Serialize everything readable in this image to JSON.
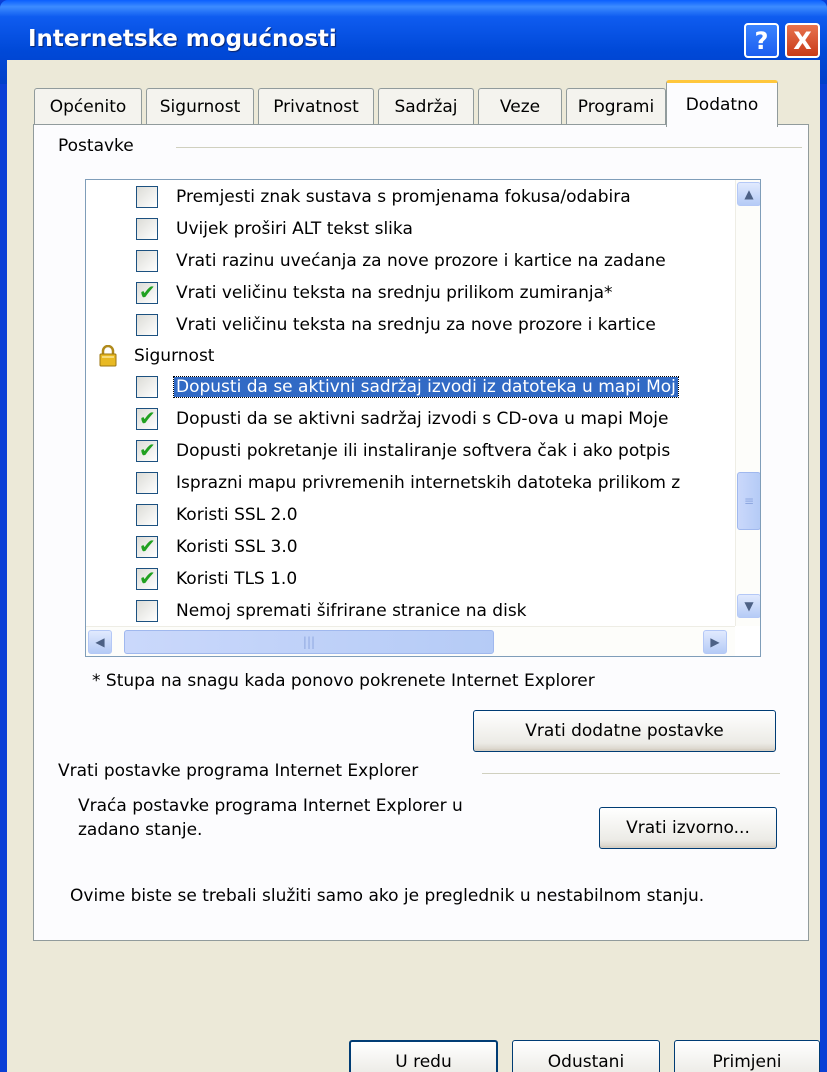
{
  "window": {
    "title": "Internetske mogućnosti",
    "help_label": "?",
    "close_label": "X"
  },
  "tabs": [
    {
      "label": "Općenito"
    },
    {
      "label": "Sigurnost"
    },
    {
      "label": "Privatnost"
    },
    {
      "label": "Sadržaj"
    },
    {
      "label": "Veze"
    },
    {
      "label": "Programi"
    },
    {
      "label": "Dodatno"
    }
  ],
  "active_tab": "Dodatno",
  "settings": {
    "group_label": "Postavke",
    "items": [
      {
        "label": "Premjesti znak sustava s promjenama fokusa/odabira",
        "checked": false
      },
      {
        "label": "Uvijek proširi ALT tekst slika",
        "checked": false
      },
      {
        "label": "Vrati razinu uvećanja za nove prozore i kartice na zadane",
        "checked": false
      },
      {
        "label": "Vrati veličinu teksta na srednju prilikom zumiranja*",
        "checked": true
      },
      {
        "label": "Vrati veličinu teksta na srednju za nove prozore i kartice",
        "checked": false
      }
    ],
    "security_category": "Sigurnost",
    "security_items": [
      {
        "label": "Dopusti da se aktivni sadržaj izvodi iz datoteka u mapi Moj",
        "checked": false,
        "selected": true
      },
      {
        "label": "Dopusti da se aktivni sadržaj izvodi s CD-ova u mapi Moje",
        "checked": true
      },
      {
        "label": "Dopusti pokretanje ili instaliranje softvera čak i ako potpis",
        "checked": true
      },
      {
        "label": "Isprazni mapu privremenih internetskih datoteka prilikom z",
        "checked": false
      },
      {
        "label": "Koristi SSL 2.0",
        "checked": false
      },
      {
        "label": "Koristi SSL 3.0",
        "checked": true
      },
      {
        "label": "Koristi TLS 1.0",
        "checked": true
      },
      {
        "label": "Nemoj spremati šifrirane stranice na disk",
        "checked": false
      }
    ],
    "scroll_up": "▲",
    "scroll_down": "▼",
    "scroll_left": "◀",
    "scroll_right": "▶",
    "grip": "|||"
  },
  "restart_note": "* Stupa na snagu kada ponovo pokrenete Internet Explorer",
  "restore_advanced_button": "Vrati dodatne postavke",
  "reset": {
    "group_label": "Vrati postavke programa Internet Explorer",
    "description_line1": "Vraća postavke programa Internet Explorer u",
    "description_line2": "zadano stanje.",
    "button_label": "Vrati izvorno...",
    "warning": "Ovime biste se trebali služiti samo ako je preglednik u nestabilnom stanju."
  },
  "footer": {
    "ok_label": "U redu",
    "cancel_label": "Odustani",
    "apply_label": "Primjeni"
  }
}
